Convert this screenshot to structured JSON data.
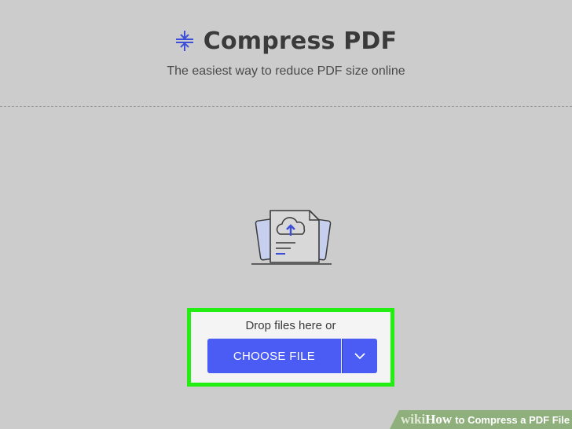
{
  "header": {
    "title": "Compress PDF",
    "subtitle": "The easiest way to reduce PDF size online",
    "icon": "compress-icon"
  },
  "illustration": {
    "icon": "document-cloud-upload-icon"
  },
  "dropzone": {
    "prompt": "Drop files here or",
    "choose_label": "CHOOSE FILE",
    "dropdown_icon": "chevron-down-icon",
    "highlight_color": "#22ee11",
    "button_color": "#4a5cf4"
  },
  "watermark": {
    "wiki": "wiki",
    "how": "How",
    "text": "to Compress a PDF File"
  }
}
